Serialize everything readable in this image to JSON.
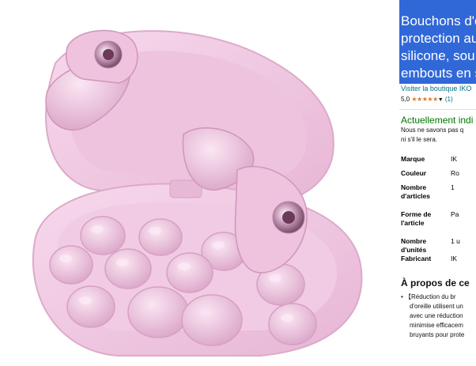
{
  "product": {
    "title_lines": [
      "Bouchons d'o",
      "protection au",
      "silicone, sou",
      "embouts en s"
    ],
    "store_link": "Visiter la boutique IKO",
    "rating": "5,0",
    "stars": "★★★★★",
    "rating_count": "(1)",
    "availability": "Actuellement indi",
    "availability_note": [
      "Nous ne savons pas q",
      "ni s'il le sera."
    ],
    "specs": [
      {
        "key": "Marque",
        "value": "IK"
      },
      {
        "key": "Couleur",
        "value": "Ro"
      },
      {
        "key": "Nombre d'articles",
        "value": "1"
      },
      {
        "key": "Forme de l'article",
        "value": "Pa"
      },
      {
        "key": "Nombre d'unités",
        "value": "1 u"
      },
      {
        "key": "Fabricant",
        "value": "IK"
      }
    ],
    "about_title": "À propos de ce",
    "about_bullets": [
      "• 【Réduction du br",
      "d'oreille utilisent un",
      "avec une réduction",
      "minimise efficacem",
      "bruyants pour prote"
    ]
  },
  "colors": {
    "title_highlight": "#3168d8",
    "link": "#007185",
    "availability": "#007600",
    "stars": "#de7921",
    "product_pink": "#f3cde6"
  },
  "image": {
    "subject": "pink silicone earplugs with charging-style case and spare ear tips"
  }
}
